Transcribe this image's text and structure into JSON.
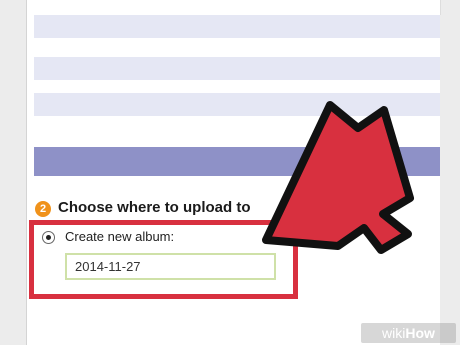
{
  "upload": {
    "step_number": "2",
    "section_title": "Choose where to upload to",
    "option_label": "Create new album:",
    "option_selected": true,
    "album_name_value": "2014-11-27"
  },
  "watermark": {
    "part1": "wiki",
    "part2": "How"
  },
  "colors": {
    "accent_header": "#8e91c7",
    "stripe": "#e5e7f4",
    "step_badge": "#f0921b",
    "highlight": "#d8303f",
    "arrow_fill": "#d8303f",
    "arrow_outline": "#111111",
    "input_border": "#cfe1a8"
  },
  "icons": {
    "arrow": "red-pointer-arrow-icon",
    "radio": "radio-selected-icon",
    "step": "step-number-badge"
  }
}
